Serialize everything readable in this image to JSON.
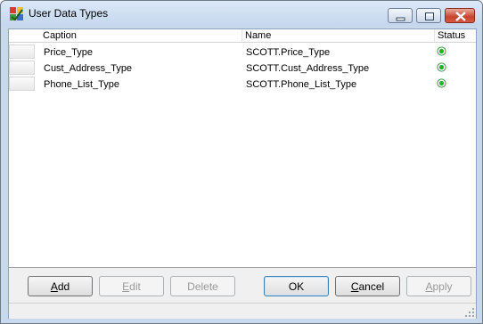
{
  "window": {
    "title": "User Data Types"
  },
  "grid": {
    "columns": [
      "Caption",
      "Name",
      "Status"
    ],
    "rows": [
      {
        "caption": "Price_Type",
        "name": "SCOTT.Price_Type",
        "status": "valid"
      },
      {
        "caption": "Cust_Address_Type",
        "name": "SCOTT.Cust_Address_Type",
        "status": "valid"
      },
      {
        "caption": "Phone_List_Type",
        "name": "SCOTT.Phone_List_Type",
        "status": "valid"
      }
    ]
  },
  "buttons": {
    "add": {
      "pre": "",
      "acc": "A",
      "post": "dd"
    },
    "edit": {
      "pre": "",
      "acc": "E",
      "post": "dit"
    },
    "delete": {
      "pre": "",
      "acc": "",
      "post": "Delete"
    },
    "ok": {
      "pre": "",
      "acc": "",
      "post": "OK"
    },
    "cancel": {
      "pre": "",
      "acc": "C",
      "post": "ancel"
    },
    "apply": {
      "pre": "",
      "acc": "A",
      "post": "pply"
    }
  },
  "colors": {
    "status_valid": "#22b32d",
    "accent": "#3c7fb1"
  },
  "icons": {
    "app": "data-types-icon",
    "status": "status-valid-icon"
  }
}
